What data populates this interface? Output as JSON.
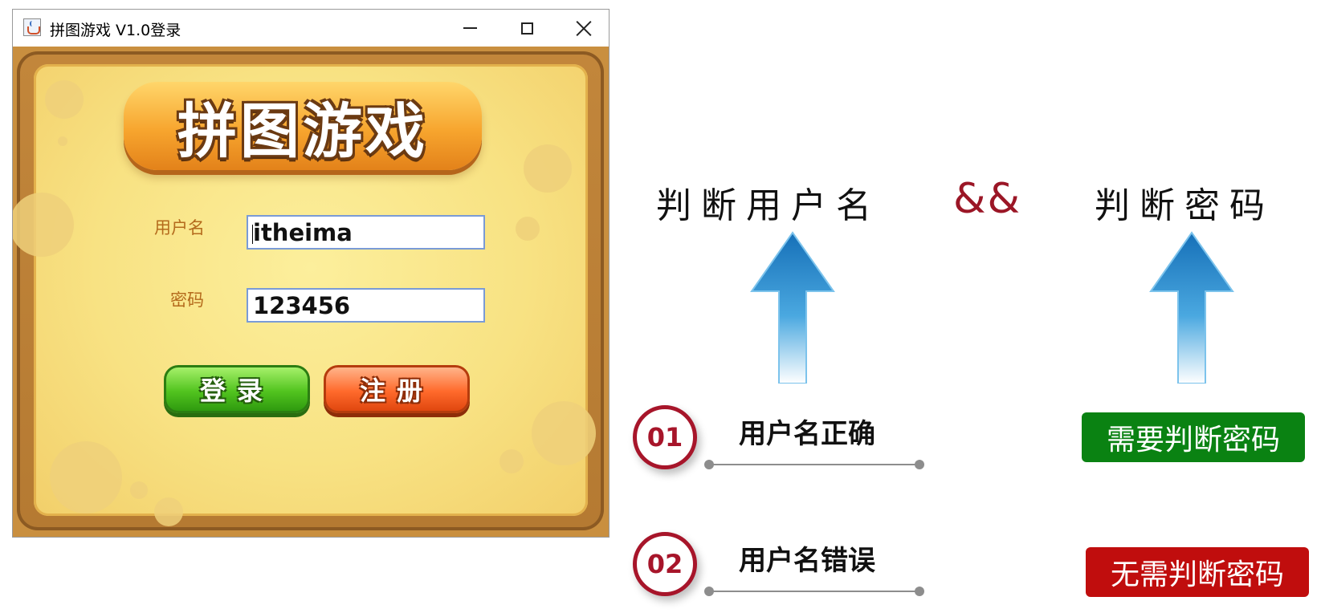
{
  "window": {
    "title": "拼图游戏 V1.0登录",
    "controls": {
      "minimize": "–",
      "maximize": "☐",
      "close": "✕"
    }
  },
  "game": {
    "banner_title": "拼图游戏",
    "username_label": "用户名",
    "username_value": "itheima",
    "password_label": "密码",
    "password_value": "123456",
    "login_button": "登录",
    "register_button": "注册"
  },
  "diagram": {
    "check_username": "判断用户名",
    "operator": "&&",
    "check_password": "判断密码",
    "cases": [
      {
        "number": "01",
        "condition": "用户名正确",
        "result": "需要判断密码",
        "result_color": "#0a8212"
      },
      {
        "number": "02",
        "condition": "用户名错误",
        "result": "无需判断密码",
        "result_color": "#c00d0d"
      }
    ],
    "accent_color": "#a7152a",
    "arrow_color": "#1c7fc6"
  }
}
